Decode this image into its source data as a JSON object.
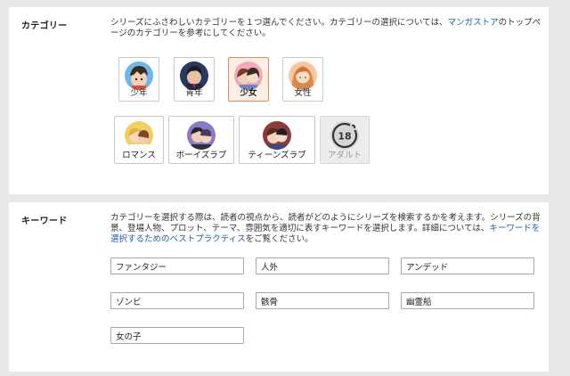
{
  "category": {
    "label": "カテゴリー",
    "description_before": "シリーズにふさわしいカテゴリーを１つ選んでください。カテゴリーの選択については、",
    "description_link": "マンガストア",
    "description_after": "のトップページのカテゴリーを参考にしてください。",
    "selected": "少女",
    "items": [
      {
        "label": "少年",
        "icon": "boy-manga-avatar-icon",
        "selected": false,
        "disabled": false
      },
      {
        "label": "青年",
        "icon": "young-man-manga-avatar-icon",
        "selected": false,
        "disabled": false
      },
      {
        "label": "少女",
        "icon": "girl-couple-manga-avatar-icon",
        "selected": true,
        "disabled": false
      },
      {
        "label": "女性",
        "icon": "woman-manga-avatar-icon",
        "selected": false,
        "disabled": false
      },
      {
        "label": "ロマンス",
        "icon": "romance-couple-avatar-icon",
        "selected": false,
        "disabled": false
      },
      {
        "label": "ボーイズラブ",
        "icon": "boys-love-avatar-icon",
        "selected": false,
        "disabled": false
      },
      {
        "label": "ティーンズラブ",
        "icon": "teens-love-avatar-icon",
        "selected": false,
        "disabled": false
      },
      {
        "label": "アダルト",
        "icon": "18-plus-icon",
        "icon_text": "18",
        "selected": false,
        "disabled": true
      }
    ]
  },
  "keywords": {
    "label": "キーワード",
    "description_before": "カテゴリーを選択する際は、読者の視点から、読者がどのようにシリーズを検索するかを考えます。シリーズの背景、登場人物、プロット、テーマ、雰囲気を適切に表すキーワードを選択します。詳細については、",
    "description_link": "キーワードを選択するためのベストプラクティス",
    "description_after": "をご覧ください。",
    "values": [
      "ファンタジー",
      "人外",
      "アンデッド",
      "ゾンビ",
      "骸骨",
      "幽霊船",
      "女の子"
    ]
  },
  "colors": {
    "background": "#e8e8e8",
    "panel": "#ffffff",
    "link": "#1a5fb4",
    "selected_border": "#e8895a",
    "selected_fill": "#fbefe6",
    "input_border": "#a8a8a8"
  }
}
